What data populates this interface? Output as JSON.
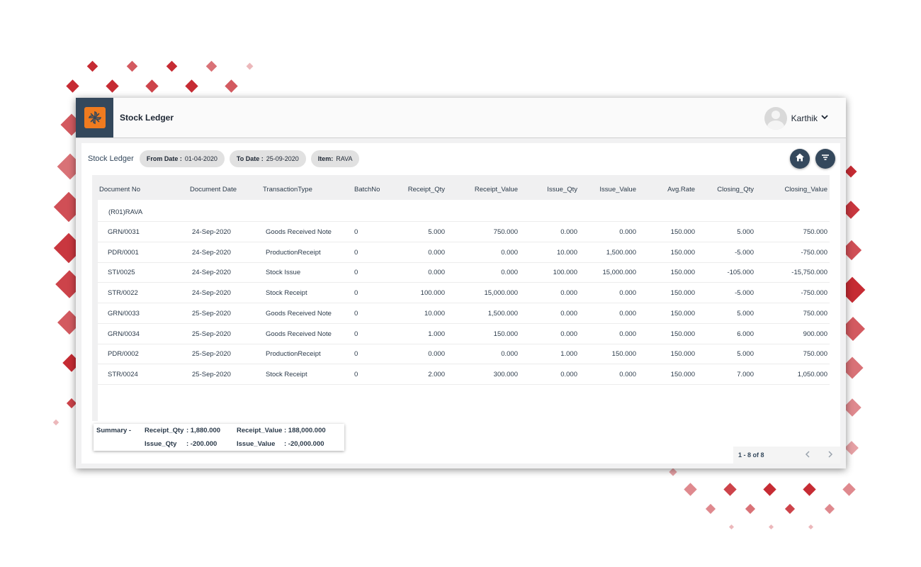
{
  "app": {
    "title": "Stock Ledger",
    "user_name": "Karthik"
  },
  "filters": {
    "label": "Stock Ledger",
    "chips": [
      {
        "label": "From Date :",
        "value": "01-04-2020"
      },
      {
        "label": "To Date :",
        "value": "25-09-2020"
      },
      {
        "label": "Item:",
        "value": "RAVA"
      }
    ]
  },
  "icons": {
    "home": "home-icon",
    "filter": "filter-list-icon",
    "prev": "chevron-left-icon",
    "next": "chevron-right-icon",
    "dropdown": "chevron-down-icon",
    "logo": "pinwheel-logo-icon"
  },
  "colors": {
    "header": "#34485c",
    "logo": "#f07b1f",
    "diamond": "#c0141d"
  },
  "table": {
    "columns": [
      "Document No",
      "Document Date",
      "TransactionType",
      "BatchNo",
      "Receipt_Qty",
      "Receipt_Value",
      "Issue_Qty",
      "Issue_Value",
      "Avg.Rate",
      "Closing_Qty",
      "Closing_Value"
    ],
    "group": "(R01)RAVA",
    "rows": [
      [
        "GRN/0031",
        "24-Sep-2020",
        "Goods Received Note",
        "0",
        "5.000",
        "750.000",
        "0.000",
        "0.000",
        "150.000",
        "5.000",
        "750.000"
      ],
      [
        "PDR/0001",
        "24-Sep-2020",
        "ProductionReceipt",
        "0",
        "0.000",
        "0.000",
        "10.000",
        "1,500.000",
        "150.000",
        "-5.000",
        "-750.000"
      ],
      [
        "STI/0025",
        "24-Sep-2020",
        "Stock Issue",
        "0",
        "0.000",
        "0.000",
        "100.000",
        "15,000.000",
        "150.000",
        "-105.000",
        "-15,750.000"
      ],
      [
        "STR/0022",
        "24-Sep-2020",
        "Stock Receipt",
        "0",
        "100.000",
        "15,000.000",
        "0.000",
        "0.000",
        "150.000",
        "-5.000",
        "-750.000"
      ],
      [
        "GRN/0033",
        "25-Sep-2020",
        "Goods Received Note",
        "0",
        "10.000",
        "1,500.000",
        "0.000",
        "0.000",
        "150.000",
        "5.000",
        "750.000"
      ],
      [
        "GRN/0034",
        "25-Sep-2020",
        "Goods Received Note",
        "0",
        "1.000",
        "150.000",
        "0.000",
        "0.000",
        "150.000",
        "6.000",
        "900.000"
      ],
      [
        "PDR/0002",
        "25-Sep-2020",
        "ProductionReceipt",
        "0",
        "0.000",
        "0.000",
        "1.000",
        "150.000",
        "150.000",
        "5.000",
        "750.000"
      ],
      [
        "STR/0024",
        "25-Sep-2020",
        "Stock Receipt",
        "0",
        "2.000",
        "300.000",
        "0.000",
        "0.000",
        "150.000",
        "7.000",
        "1,050.000"
      ]
    ]
  },
  "summary": {
    "label": "Summary -",
    "receipt_qty_label": "Receipt_Qty",
    "receipt_qty_value": ": 1,880.000",
    "receipt_value_label": "Receipt_Value",
    "receipt_value_value": ": 188,000.000",
    "issue_qty_label": "Issue_Qty",
    "issue_qty_value": ": -200.000",
    "issue_value_label": "Issue_Value",
    "issue_value_value": ": -20,000.000"
  },
  "pagination": {
    "range": "1 - 8 of 8"
  }
}
